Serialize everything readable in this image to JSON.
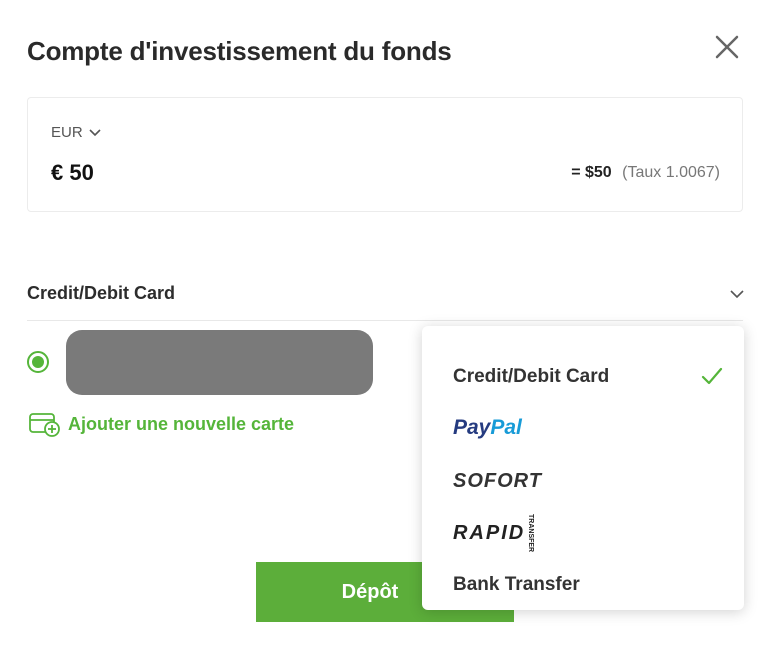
{
  "header": {
    "title": "Compte d'investissement du fonds"
  },
  "amount": {
    "currency": "EUR",
    "value": "€ 50",
    "converted": "= $50",
    "rate_text": "(Taux 1.0067)"
  },
  "payment": {
    "method_label": "Credit/Debit Card",
    "add_card_label": "Ajouter une nouvelle carte"
  },
  "dropdown": {
    "options": [
      {
        "label": "Credit/Debit Card",
        "selected": true
      },
      {
        "label_a": "Pay",
        "label_b": "Pal"
      },
      {
        "label": "SOFORT"
      },
      {
        "label": "RAPID",
        "tag": "TRANSFER"
      },
      {
        "label": "Bank Transfer"
      }
    ]
  },
  "actions": {
    "deposit_label": "Dépôt"
  },
  "colors": {
    "accent": "#5cae3a",
    "paypal_dark": "#253b80",
    "paypal_light": "#179bd7"
  }
}
